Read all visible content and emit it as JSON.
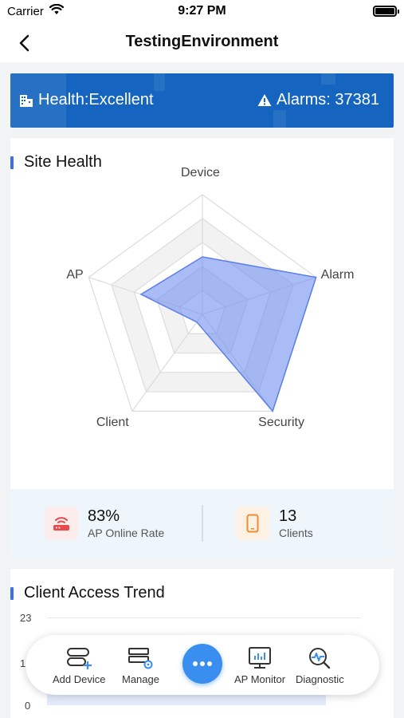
{
  "status_bar": {
    "carrier": "Carrier",
    "time": "9:27 PM"
  },
  "nav": {
    "title": "TestingEnvironment"
  },
  "banner": {
    "health": "Health:Excellent",
    "alarms": "Alarms: 37381",
    "color": "#1565c0"
  },
  "site_health": {
    "title": "Site Health",
    "axes": [
      "Device",
      "Alarm",
      "Security",
      "Client",
      "AP"
    ],
    "values": [
      0.48,
      1.0,
      1.0,
      0.08,
      0.54
    ],
    "fill_color": "#6f8ff0"
  },
  "stats": {
    "ap_online": {
      "value": "83%",
      "label": "AP Online Rate",
      "icon": "router-icon",
      "color": "#e94b4b"
    },
    "clients": {
      "value": "13",
      "label": "Clients",
      "icon": "phone-icon",
      "color": "#f08a2c"
    }
  },
  "client_trend": {
    "title": "Client Access Trend",
    "y_max": "23",
    "y_min": "0",
    "y_mid": "1"
  },
  "actions": {
    "add_device": "Add Device",
    "manage": "Manage",
    "ap_monitor": "AP Monitor",
    "diagnostic": "Diagnostic"
  }
}
